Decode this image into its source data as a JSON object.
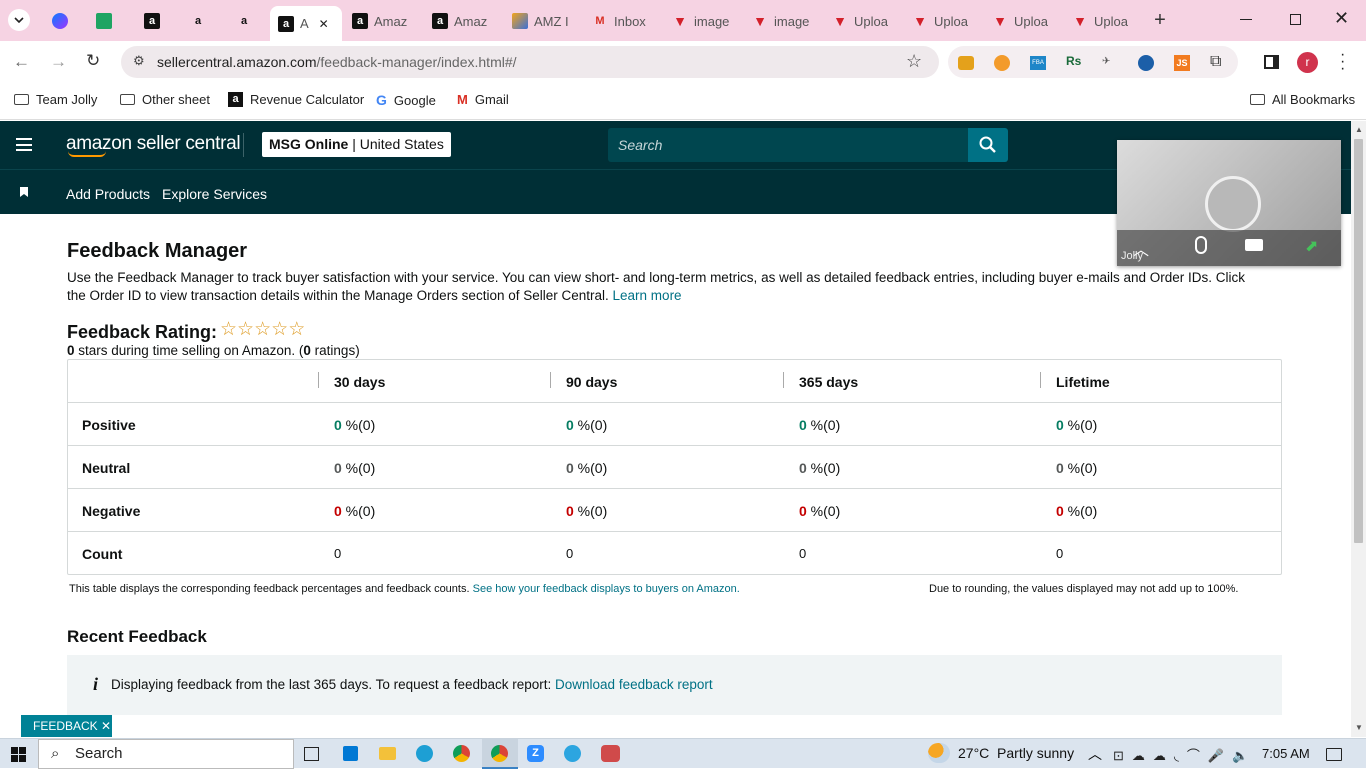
{
  "browser": {
    "tabs": [
      {
        "label": "",
        "icon": "messenger-icon"
      },
      {
        "label": "",
        "icon": "sheets-icon"
      },
      {
        "label": "",
        "icon": "amazon-icon"
      },
      {
        "label": "",
        "icon": "amazon-smile-icon"
      },
      {
        "label": "",
        "icon": "amazon-smile-icon"
      },
      {
        "label": "A",
        "icon": "amazon-icon",
        "active": true
      },
      {
        "label": "Amaz",
        "icon": "amazon-icon"
      },
      {
        "label": "Amaz",
        "icon": "amazon-icon"
      },
      {
        "label": "AMZ I",
        "icon": "amz-icon"
      },
      {
        "label": "Inbox",
        "icon": "gmail-icon"
      },
      {
        "label": "image",
        "icon": "vd-icon"
      },
      {
        "label": "image",
        "icon": "vd-icon"
      },
      {
        "label": "Uploa",
        "icon": "vd-icon"
      },
      {
        "label": "Uploa",
        "icon": "vd-icon"
      },
      {
        "label": "Uploa",
        "icon": "vd-icon"
      },
      {
        "label": "Uploa",
        "icon": "vd-icon"
      }
    ],
    "url_host": "sellercentral.amazon.com",
    "url_path": "/feedback-manager/index.html#/",
    "profile_initial": "r",
    "bookmarks": [
      "Team Jolly",
      "Other sheet",
      "Revenue Calculator",
      "Google",
      "Gmail"
    ],
    "all_bookmarks": "All Bookmarks"
  },
  "seller_central": {
    "logo": "amazon seller central",
    "store_name": "MSG Online",
    "marketplace": "United States",
    "search_placeholder": "Search",
    "nav": [
      "Add Products",
      "Explore Services"
    ]
  },
  "video_call": {
    "name": "Jolly"
  },
  "main": {
    "title": "Feedback Manager",
    "description": "Use the Feedback Manager to track buyer satisfaction with your service. You can view short- and long-term metrics, as well as detailed feedback entries, including buyer e-mails and Order IDs. Click the Order ID to view transaction details within the Manage Orders section of Seller Central.",
    "learn_more": "Learn more",
    "rating_label": "Feedback Rating:",
    "stars_value": "0",
    "stars_text": "stars during time selling on Amazon. (",
    "ratings_count": "0",
    "ratings_text": "ratings)",
    "columns": [
      "30 days",
      "90 days",
      "365 days",
      "Lifetime"
    ],
    "rows": [
      {
        "label": "Positive",
        "cells": [
          "0",
          "0",
          "0",
          "0"
        ],
        "suffix": "%(0)"
      },
      {
        "label": "Neutral",
        "cells": [
          "0",
          "0",
          "0",
          "0"
        ],
        "suffix": "%(0)"
      },
      {
        "label": "Negative",
        "cells": [
          "0",
          "0",
          "0",
          "0"
        ],
        "suffix": "%(0)"
      },
      {
        "label": "Count",
        "cells": [
          "0",
          "0",
          "0",
          "0"
        ]
      }
    ],
    "table_note": "This table displays the corresponding feedback percentages and feedback counts.",
    "table_note_link": "See how your feedback displays to buyers on Amazon.",
    "rounding_note": "Due to rounding, the values displayed may not add up to 100%.",
    "recent_title": "Recent Feedback",
    "recent_info": "Displaying feedback from the last 365 days. To request a feedback report:",
    "recent_link": "Download feedback report",
    "feedback_tab": "FEEDBACK"
  },
  "taskbar": {
    "search": "Search",
    "weather": "27°C  Partly sunny",
    "time": "7:05 AM"
  }
}
